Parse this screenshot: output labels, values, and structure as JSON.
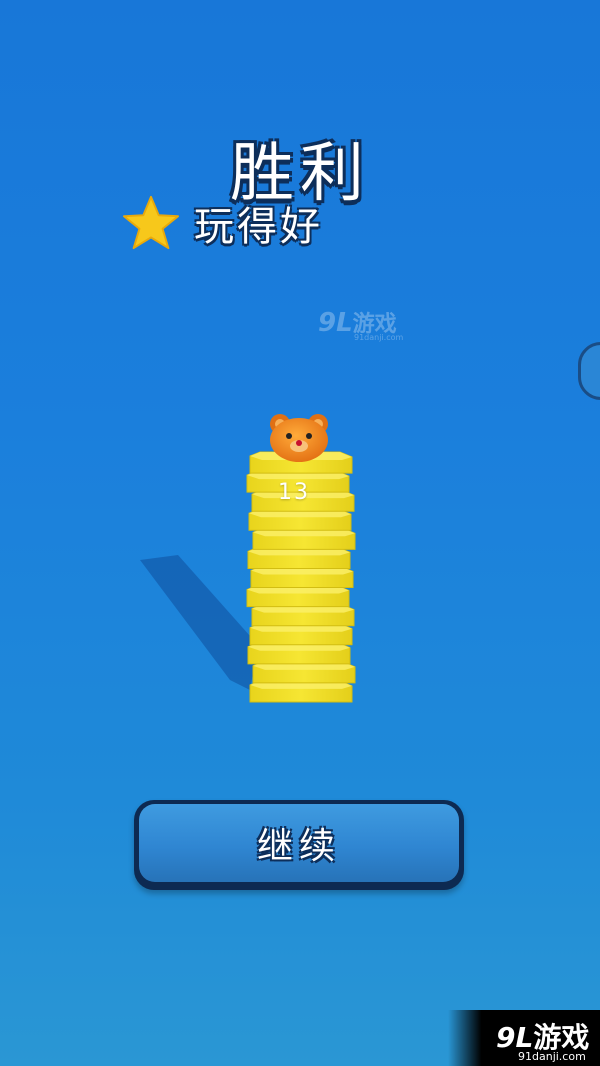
{
  "result": {
    "title": "胜利",
    "subtitle": "玩得好",
    "stars": 1,
    "star_color": "#f7c81b"
  },
  "game": {
    "stack_count": "13",
    "tile_color": "#f2e22a",
    "character": "bear-head-icon"
  },
  "continue_button": {
    "label": "继续",
    "color": "#2f86d2"
  },
  "watermark_top": {
    "logo": "9L",
    "name": "游戏",
    "url": "91danji.com"
  },
  "watermark_corner": {
    "logo": "9L",
    "name": "游戏",
    "url": "91danji.com"
  }
}
